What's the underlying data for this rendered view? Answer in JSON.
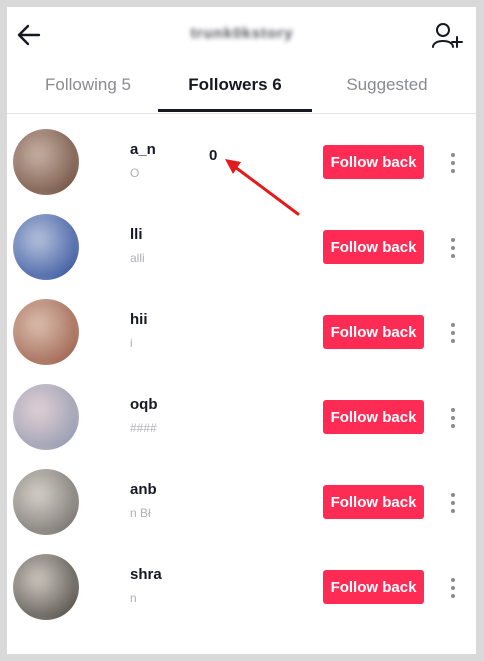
{
  "header": {
    "title": "trunk0kstory",
    "back_icon": "arrow-left-icon",
    "add_icon": "add-user-icon"
  },
  "tabs": [
    {
      "label": "Following 5",
      "active": false
    },
    {
      "label": "Followers 6",
      "active": true
    },
    {
      "label": "Suggested",
      "active": false
    }
  ],
  "followers": [
    {
      "name": "a_n",
      "handle": "O",
      "button_label": "Follow back",
      "avatar_colors": [
        "#6b4a3a",
        "#c9b3a6"
      ]
    },
    {
      "name": "lli",
      "handle": "alli",
      "button_label": "Follow back",
      "avatar_colors": [
        "#2f4f9a",
        "#b8c4de"
      ]
    },
    {
      "name": "hii",
      "handle": "i",
      "button_label": "Follow back",
      "avatar_colors": [
        "#9a5a46",
        "#dcc0b0"
      ]
    },
    {
      "name": "oqb",
      "handle": "####",
      "button_label": "Follow back",
      "avatar_colors": [
        "#8d96ad",
        "#e3d1d6"
      ]
    },
    {
      "name": "anb",
      "handle": "n Bł",
      "button_label": "Follow back",
      "avatar_colors": [
        "#6f6a66",
        "#d7d2cc"
      ]
    },
    {
      "name": "shra",
      "handle": "n",
      "button_label": "Follow back",
      "avatar_colors": [
        "#4a4540",
        "#cfc9c1"
      ]
    }
  ],
  "annotation": {
    "text": "0",
    "arrow_color": "#e31b1b"
  },
  "colors": {
    "accent": "#fe2c55",
    "text_primary": "#161823",
    "text_secondary": "#8a8b91"
  }
}
